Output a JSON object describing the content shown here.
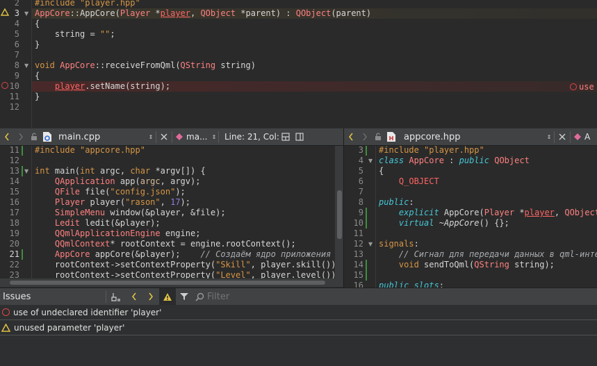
{
  "top_editor": {
    "lines": [
      {
        "n": "2",
        "segs": [
          [
            "inc",
            "#include \"player.hpp\""
          ]
        ]
      },
      {
        "n": "3",
        "segs": [
          [
            "ty",
            "AppCore"
          ],
          [
            "fn",
            "::"
          ],
          [
            "fn",
            "AppCore("
          ],
          [
            "ty",
            "Player"
          ],
          [
            "fn",
            " *"
          ],
          [
            "pl",
            "player"
          ],
          [
            "fn",
            ", "
          ],
          [
            "ty",
            "QObject"
          ],
          [
            "fn",
            " *parent) : "
          ],
          [
            "ty",
            "QObject"
          ],
          [
            "fn",
            "(parent)"
          ]
        ]
      },
      {
        "n": "4",
        "segs": [
          [
            "fn",
            "{"
          ]
        ]
      },
      {
        "n": "5",
        "segs": [
          [
            "fn",
            "    string = "
          ],
          [
            "str",
            "\"\""
          ],
          [
            "fn",
            ";"
          ]
        ]
      },
      {
        "n": "6",
        "segs": [
          [
            "fn",
            "}"
          ]
        ]
      },
      {
        "n": "7",
        "segs": [
          [
            "fn",
            ""
          ]
        ]
      },
      {
        "n": "8",
        "segs": [
          [
            "kw",
            "void"
          ],
          [
            "fn",
            " "
          ],
          [
            "ty",
            "AppCore"
          ],
          [
            "fn",
            "::receiveFromQml("
          ],
          [
            "ty",
            "QString"
          ],
          [
            "fn",
            " string)"
          ]
        ]
      },
      {
        "n": "9",
        "segs": [
          [
            "fn",
            "{"
          ]
        ]
      },
      {
        "n": "10",
        "segs": [
          [
            "fn",
            "    "
          ],
          [
            "pl",
            "player"
          ],
          [
            "fn",
            ".setName(string);"
          ]
        ]
      },
      {
        "n": "11",
        "segs": [
          [
            "fn",
            "}"
          ]
        ]
      },
      {
        "n": "12",
        "segs": [
          [
            "fn",
            ""
          ]
        ]
      }
    ],
    "inline_error": "use"
  },
  "left_editor": {
    "toolbar": {
      "back_icon": "chevron-left-icon",
      "forward_icon": "chevron-right-icon",
      "filename": "main.cpp",
      "symbol": "ma...",
      "position": "Line: 21, Col:"
    },
    "lines": [
      {
        "n": "11",
        "segs": [
          [
            "inc",
            "#include \"appcore.hpp\""
          ]
        ]
      },
      {
        "n": "12",
        "segs": [
          [
            "fn",
            ""
          ]
        ]
      },
      {
        "n": "13",
        "segs": [
          [
            "kw",
            "int"
          ],
          [
            "fn",
            " main("
          ],
          [
            "kw",
            "int"
          ],
          [
            "fn",
            " argc, "
          ],
          [
            "kw",
            "char"
          ],
          [
            "fn",
            " *argv[]) {"
          ]
        ]
      },
      {
        "n": "14",
        "segs": [
          [
            "fn",
            "    "
          ],
          [
            "ty",
            "QApplication"
          ],
          [
            "fn",
            " app("
          ],
          [
            "field",
            "argc"
          ],
          [
            "fn",
            ", argv);"
          ]
        ]
      },
      {
        "n": "15",
        "segs": [
          [
            "fn",
            "    "
          ],
          [
            "ty",
            "QFile"
          ],
          [
            "fn",
            " file("
          ],
          [
            "str",
            "\"config.json\""
          ],
          [
            "fn",
            ");"
          ]
        ]
      },
      {
        "n": "16",
        "segs": [
          [
            "fn",
            "    "
          ],
          [
            "ty",
            "Player"
          ],
          [
            "fn",
            " player("
          ],
          [
            "str",
            "\"rason\""
          ],
          [
            "fn",
            ", "
          ],
          [
            "num",
            "17"
          ],
          [
            "fn",
            ");"
          ]
        ]
      },
      {
        "n": "17",
        "segs": [
          [
            "fn",
            "    "
          ],
          [
            "ty",
            "SimpleMenu"
          ],
          [
            "fn",
            " window(&player, &file);"
          ]
        ]
      },
      {
        "n": "18",
        "segs": [
          [
            "fn",
            "    "
          ],
          [
            "ty",
            "Ledit"
          ],
          [
            "fn",
            " ledit(&player);"
          ]
        ]
      },
      {
        "n": "19",
        "segs": [
          [
            "fn",
            "    "
          ],
          [
            "ty",
            "QQmlApplicationEngine"
          ],
          [
            "fn",
            " engine;"
          ]
        ]
      },
      {
        "n": "20",
        "segs": [
          [
            "fn",
            "    "
          ],
          [
            "ty",
            "QQmlContext"
          ],
          [
            "fn",
            "* rootContext = engine.rootContext();"
          ]
        ]
      },
      {
        "n": "21",
        "segs": [
          [
            "fn",
            "    "
          ],
          [
            "ty",
            "AppCore"
          ],
          [
            "fn",
            " appCore(&player);    "
          ],
          [
            "cm",
            "// Создаём ядро приложения"
          ]
        ]
      },
      {
        "n": "22",
        "segs": [
          [
            "fn",
            "    rootContext->setContextProperty("
          ],
          [
            "str",
            "\"Skill\""
          ],
          [
            "fn",
            ", player.skill());"
          ]
        ]
      },
      {
        "n": "23",
        "segs": [
          [
            "fn",
            "    rootContext->setContextProperty("
          ],
          [
            "str",
            "\"Level\""
          ],
          [
            "fn",
            ", player.level());"
          ]
        ]
      }
    ]
  },
  "right_editor": {
    "toolbar": {
      "filename": "appcore.hpp",
      "symbol": "A"
    },
    "lines": [
      {
        "n": "3",
        "segs": [
          [
            "inc",
            "#include \"player.hpp\""
          ]
        ]
      },
      {
        "n": "4",
        "segs": [
          [
            "ital-kw",
            "class"
          ],
          [
            "fn",
            " "
          ],
          [
            "ty",
            "AppCore"
          ],
          [
            "fn",
            " : "
          ],
          [
            "ital-kw",
            "public"
          ],
          [
            "fn",
            " "
          ],
          [
            "ty",
            "QObject"
          ]
        ]
      },
      {
        "n": "5",
        "segs": [
          [
            "fn",
            "{"
          ]
        ]
      },
      {
        "n": "6",
        "segs": [
          [
            "fn",
            "    "
          ],
          [
            "macro",
            "Q_OBJECT"
          ]
        ]
      },
      {
        "n": "7",
        "segs": [
          [
            "fn",
            ""
          ]
        ]
      },
      {
        "n": "8",
        "segs": [
          [
            "ital-kw",
            "public"
          ],
          [
            "fn",
            ":"
          ]
        ]
      },
      {
        "n": "9",
        "segs": [
          [
            "fn",
            "    "
          ],
          [
            "ital-kw",
            "explicit"
          ],
          [
            "fn",
            " AppCore("
          ],
          [
            "ty",
            "Player"
          ],
          [
            "fn",
            " *"
          ],
          [
            "pl",
            "player"
          ],
          [
            "fn",
            ", "
          ],
          [
            "ty",
            "QObject"
          ],
          [
            "fn",
            " *p"
          ]
        ]
      },
      {
        "n": "10",
        "segs": [
          [
            "fn",
            "    "
          ],
          [
            "ital-kw",
            "virtual"
          ],
          [
            "fn",
            " ~"
          ],
          [
            "it",
            "AppCore"
          ],
          [
            "fn",
            "() {};"
          ]
        ]
      },
      {
        "n": "11",
        "segs": [
          [
            "fn",
            ""
          ]
        ]
      },
      {
        "n": "12",
        "segs": [
          [
            "kw",
            "signals"
          ],
          [
            "fn",
            ":"
          ]
        ]
      },
      {
        "n": "13",
        "segs": [
          [
            "fn",
            "    "
          ],
          [
            "cm",
            "// Сигнал для передачи данных в qml-интер"
          ]
        ]
      },
      {
        "n": "14",
        "segs": [
          [
            "fn",
            "    "
          ],
          [
            "kw",
            "void"
          ],
          [
            "fn",
            " sendToQml("
          ],
          [
            "ty",
            "QString"
          ],
          [
            "fn",
            " string);"
          ]
        ]
      },
      {
        "n": "15",
        "segs": [
          [
            "fn",
            ""
          ]
        ]
      },
      {
        "n": "16",
        "segs": [
          [
            "ital-kw",
            "public slots"
          ],
          [
            "fn",
            ":"
          ]
        ]
      }
    ]
  },
  "issues": {
    "title": "Issues",
    "filter_placeholder": "Filter",
    "items": [
      {
        "kind": "error",
        "text": "use of undeclared identifier 'player'"
      },
      {
        "kind": "warning",
        "text": "unused parameter 'player'"
      }
    ]
  },
  "colors": {
    "error": "#e04646",
    "warning": "#e0c246",
    "changebar": "#3e8e3e"
  }
}
